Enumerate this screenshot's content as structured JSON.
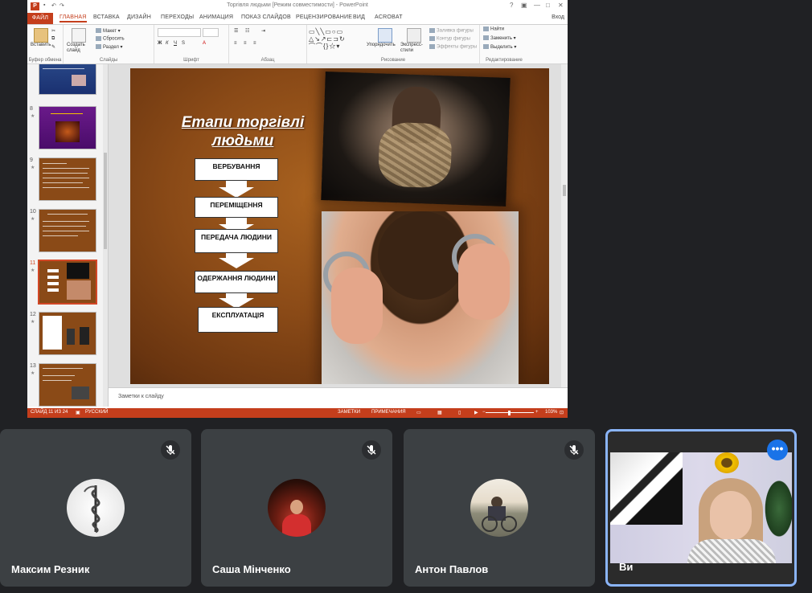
{
  "ppt": {
    "window_title": "Торгівля людьми [Режим совместимости] - PowerPoint",
    "tabs": [
      "ФАЙЛ",
      "ГЛАВНАЯ",
      "ВСТАВКА",
      "ДИЗАЙН",
      "ПЕРЕХОДЫ",
      "АНИМАЦИЯ",
      "ПОКАЗ СЛАЙДОВ",
      "РЕЦЕНЗИРОВАНИЕ",
      "ВИД",
      "ACROBAT"
    ],
    "active_tab": "ГЛАВНАЯ",
    "user": "Вход",
    "ribbon": {
      "paste": "Вставить",
      "create_slide": "Создать слайд",
      "layout": "Макет",
      "reset": "Сбросить",
      "section": "Раздел",
      "arrange": "Упорядочить",
      "quick_styles": "Экспресс-стили",
      "shape_fill": "Заливка фигуры",
      "shape_outline": "Контур фигуры",
      "shape_effects": "Эффекты фигуры",
      "find": "Найти",
      "replace": "Заменить",
      "select": "Выделить",
      "groups": {
        "clipboard": "Буфер обмена",
        "slides": "Слайды",
        "font": "Шрифт",
        "paragraph": "Абзац",
        "drawing": "Рисование",
        "editing": "Редактирование"
      }
    },
    "thumbnails": [
      {
        "num": "8"
      },
      {
        "num": "9"
      },
      {
        "num": "10"
      },
      {
        "num": "11"
      },
      {
        "num": "12"
      },
      {
        "num": "13"
      }
    ],
    "selected_slide": "11",
    "slide": {
      "title": "Етапи торгівлі людьми",
      "steps": [
        "ВЕРБУВАННЯ",
        "ПЕРЕМІЩЕННЯ",
        "ПЕРЕДАЧА   ЛЮДИНИ",
        "ОДЕРЖАННЯ ЛЮДИНИ",
        "ЕКСПЛУАТАЦІЯ"
      ]
    },
    "notes_placeholder": "Заметки к слайду",
    "status": {
      "slide": "СЛАЙД 11 ИЗ 24",
      "lang": "РУССКИЙ",
      "notes": "ЗАМЕТКИ",
      "comments": "ПРИМЕЧАНИЯ",
      "zoom": "103%"
    }
  },
  "participants": [
    {
      "name": "Максим Резник",
      "muted": true
    },
    {
      "name": "Саша Мінченко",
      "muted": true
    },
    {
      "name": "Антон Павлов",
      "muted": true
    },
    {
      "name": "Ви",
      "muted": false
    }
  ],
  "colors": {
    "meet_bg": "#202124",
    "tile_bg": "#3c4043",
    "self_border": "#8ab4f8",
    "ppt_accent": "#c43e1c"
  }
}
